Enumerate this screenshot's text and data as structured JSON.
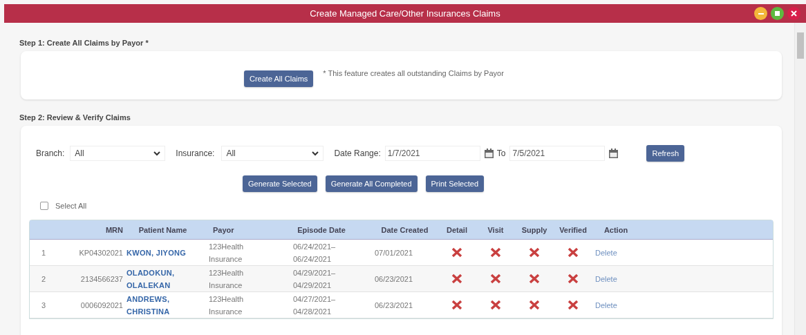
{
  "window": {
    "title": "Create Managed Care/Other Insurances Claims"
  },
  "step1": {
    "heading": "Step 1: Create All Claims by Payor *",
    "button": "Create All Claims",
    "note": "* This feature creates all outstanding Claims by Payor"
  },
  "step2": {
    "heading": "Step 2: Review & Verify Claims",
    "filters": {
      "branch_label": "Branch:",
      "branch_value": "All",
      "insurance_label": "Insurance:",
      "insurance_value": "All",
      "date_label": "Date Range:",
      "date_from": "1/7/2021",
      "to_label": "To",
      "date_to": "7/5/2021",
      "refresh": "Refresh"
    },
    "buttons": [
      "Generate Selected",
      "Generate All Completed",
      "Print Selected"
    ],
    "select_all": {
      "label": "Select All",
      "checked": false
    }
  },
  "table": {
    "columns": [
      "",
      "MRN",
      "Patient Name",
      "Payor",
      "Episode Date",
      "Date Created",
      "Detail",
      "Visit",
      "Supply",
      "Verified",
      "Action"
    ],
    "rows": [
      {
        "index": "1",
        "mrn": "KP04302021",
        "patient": [
          "KWON, JIYONG"
        ],
        "payor": [
          "123Health",
          "Insurance"
        ],
        "episode": [
          "06/24/2021–",
          "06/24/2021"
        ],
        "created": "07/01/2021",
        "detail": false,
        "visit": false,
        "supply": false,
        "verified": false,
        "action": "Delete"
      },
      {
        "index": "2",
        "mrn": "2134566237",
        "patient": [
          "OLADOKUN,",
          "OLALEKAN"
        ],
        "payor": [
          "123Health",
          "Insurance"
        ],
        "episode": [
          "04/29/2021–",
          "04/29/2021"
        ],
        "created": "06/23/2021",
        "detail": false,
        "visit": false,
        "supply": false,
        "verified": false,
        "action": "Delete"
      },
      {
        "index": "3",
        "mrn": "0006092021",
        "patient": [
          "ANDREWS,",
          "CHRISTINA"
        ],
        "payor": [
          "123Health",
          "Insurance"
        ],
        "episode": [
          "04/27/2021–",
          "04/28/2021"
        ],
        "created": "06/23/2021",
        "detail": false,
        "visit": false,
        "supply": false,
        "verified": false,
        "action": "Delete"
      }
    ]
  }
}
